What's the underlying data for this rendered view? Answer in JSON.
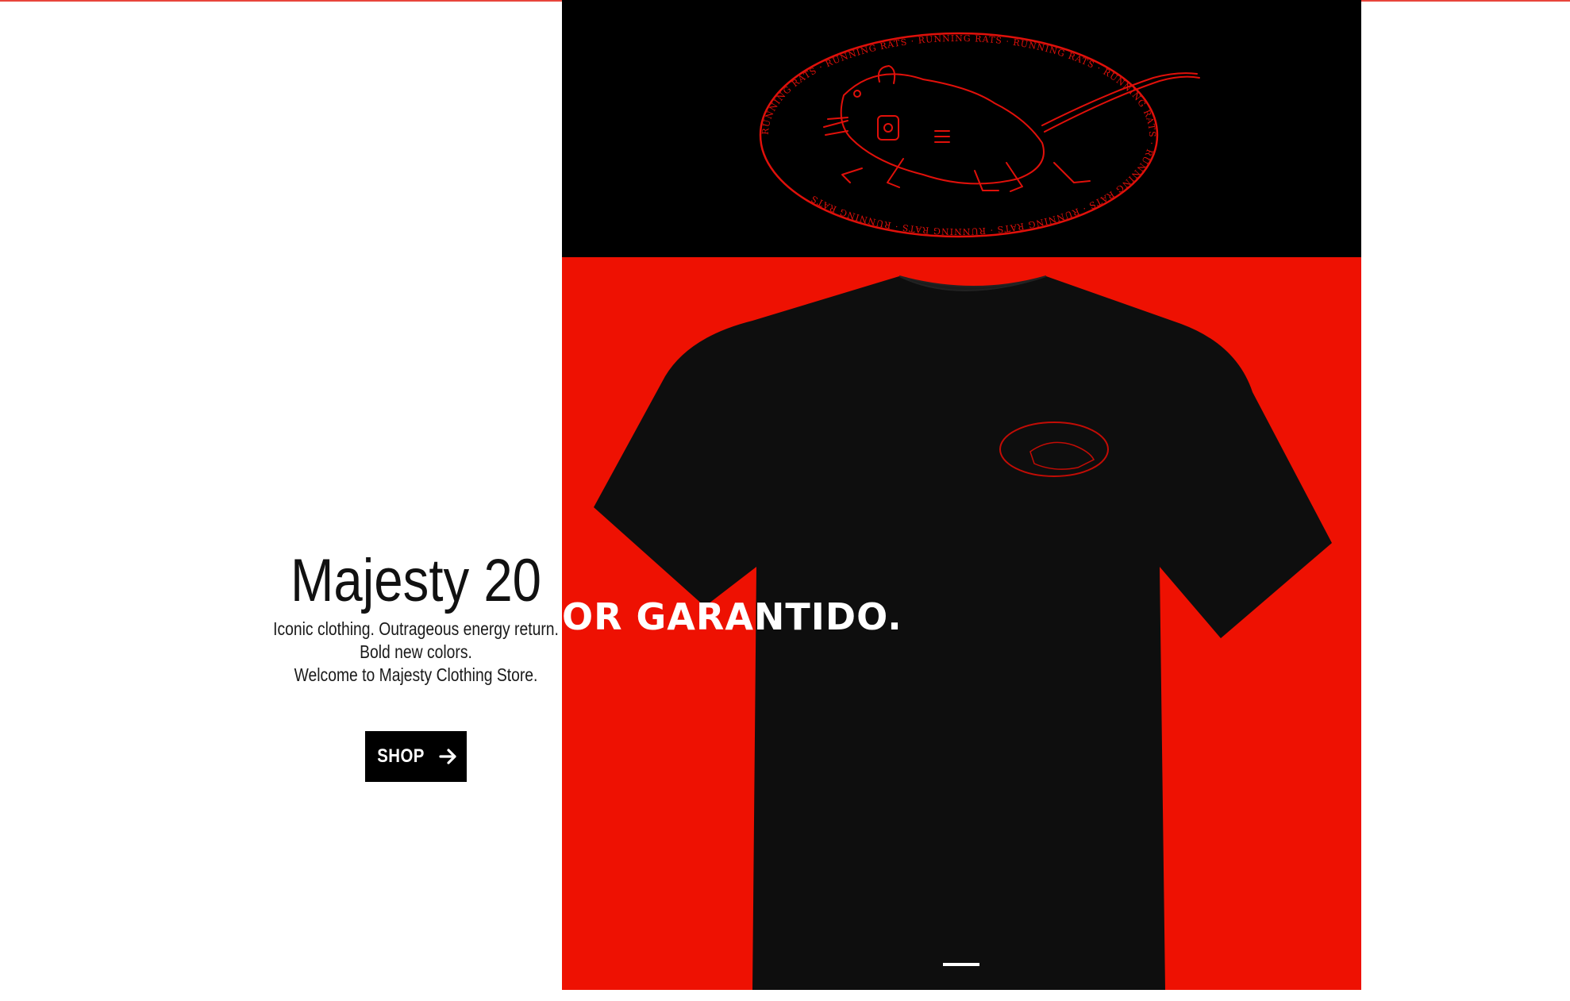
{
  "hero": {
    "title": "Majesty 20",
    "subtitle_lines": [
      "Iconic clothing. Outrageous energy return.",
      "Bold new colors.",
      "Welcome to Majesty Clothing Store."
    ],
    "button_label": "SHOP",
    "button_icon": "arrow-right-icon",
    "image_overlay_text": "OR GARANTIDO.",
    "logo_text": "RUNNING RATS"
  },
  "colors": {
    "hero_red": "#ee1102",
    "band_black": "#000000",
    "accent_line": "#e8453c",
    "button_bg": "#000000"
  },
  "slider": {
    "active_index": 1,
    "total": 1
  }
}
